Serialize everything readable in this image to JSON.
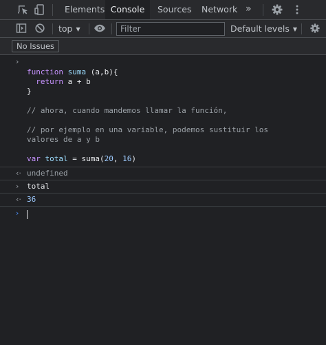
{
  "tabs": {
    "items": [
      {
        "label": "Elements",
        "active": false
      },
      {
        "label": "Console",
        "active": true
      },
      {
        "label": "Sources",
        "active": false
      },
      {
        "label": "Network",
        "active": false
      }
    ],
    "more": "»"
  },
  "toolbar": {
    "context": "top",
    "filter_placeholder": "Filter",
    "levels": "Default levels"
  },
  "issues": {
    "label": "No Issues"
  },
  "console": {
    "input_block": {
      "l1_kw": "function",
      "l1_fn": "suma",
      "l1_rest": " (a,b){",
      "l2_kw": "return",
      "l2_rest": " a + b",
      "l3": "}",
      "c1": "// ahora, cuando mandemos llamar la función,",
      "c2": "// por ejemplo en una variable, podemos sustituir los",
      "c3": "valores de a y b",
      "v_kw": "var",
      "v_name": "total",
      "v_mid": " = suma(",
      "v_n1": "20",
      "v_comma": ", ",
      "v_n2": "16",
      "v_end": ")"
    },
    "out1": "undefined",
    "in2": "total",
    "out2": "36"
  },
  "colors": {
    "background": "#202124",
    "toolbar": "#292a2d",
    "keyword": "#c793ff",
    "number": "#9ecbff",
    "prompt": "#4c8df6"
  },
  "icons": [
    "inspect-element-icon",
    "device-toolbar-icon",
    "settings-gear-icon",
    "more-vertical-icon",
    "sidebar-toggle-icon",
    "clear-console-icon",
    "eye-icon",
    "console-settings-icon"
  ]
}
